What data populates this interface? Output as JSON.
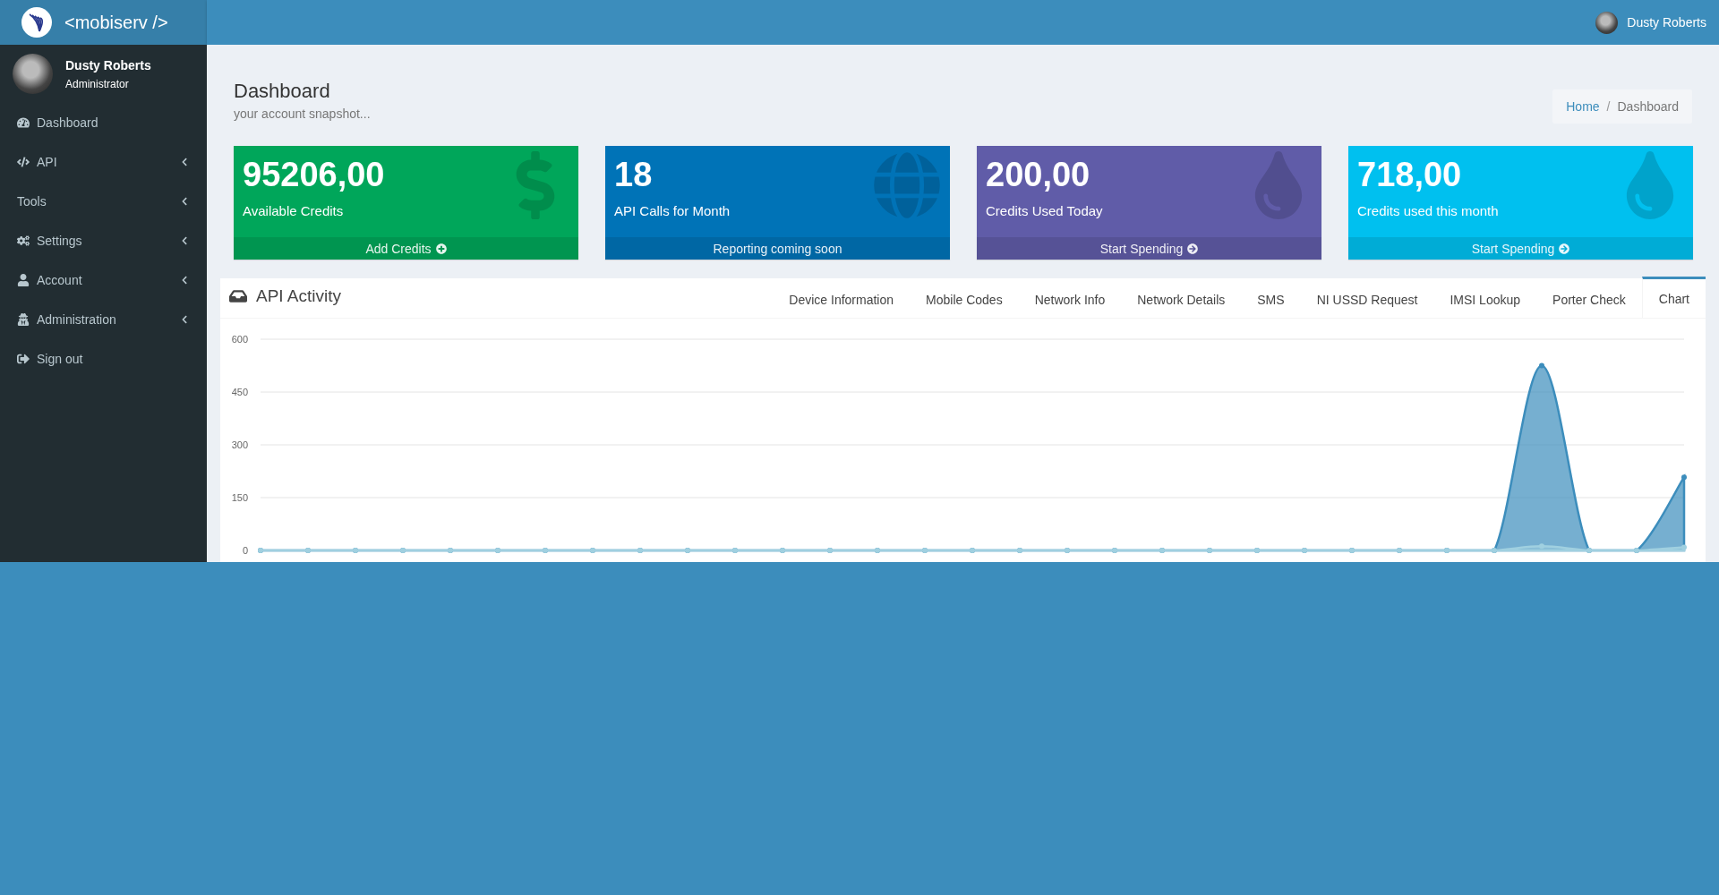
{
  "header": {
    "logo_text": "<mobiserv />",
    "user_name": "Dusty Roberts"
  },
  "sidebar": {
    "user": {
      "name": "Dusty Roberts",
      "role": "Administrator"
    },
    "items": [
      {
        "label": "Dashboard",
        "expandable": false
      },
      {
        "label": "API",
        "expandable": true
      },
      {
        "label": "Tools",
        "expandable": true
      },
      {
        "label": "Settings",
        "expandable": true
      },
      {
        "label": "Account",
        "expandable": true
      },
      {
        "label": "Administration",
        "expandable": true
      },
      {
        "label": "Sign out",
        "expandable": false
      }
    ]
  },
  "page": {
    "title": "Dashboard",
    "subtitle": "your account snapshot...",
    "breadcrumb": [
      "Home",
      "Dashboard"
    ],
    "breadcrumb_separator": "/"
  },
  "cards": [
    {
      "value": "95206,00",
      "label": "Available Credits",
      "footer": "Add Credits",
      "color": "#00a65a"
    },
    {
      "value": "18",
      "label": "API Calls for Month",
      "footer": "Reporting coming soon",
      "color": "#0073b7"
    },
    {
      "value": "200,00",
      "label": "Credits Used Today",
      "footer": "Start Spending",
      "color": "#605ca8"
    },
    {
      "value": "718,00",
      "label": "Credits used this month",
      "footer": "Start Spending",
      "color": "#00c0ef"
    }
  ],
  "activity": {
    "title": "API Activity",
    "tabs": [
      {
        "label": "Device Information",
        "selected": false
      },
      {
        "label": "Mobile Codes",
        "selected": false
      },
      {
        "label": "Network Info",
        "selected": false
      },
      {
        "label": "Network Details",
        "selected": false
      },
      {
        "label": "SMS",
        "selected": false
      },
      {
        "label": "NI USSD Request",
        "selected": false
      },
      {
        "label": "IMSI Lookup",
        "selected": false
      },
      {
        "label": "Porter Check",
        "selected": false
      },
      {
        "label": "Chart",
        "selected": true
      }
    ],
    "chart_data": {
      "type": "area",
      "grid": true,
      "ylim": [
        0,
        600
      ],
      "yticks": [
        0,
        150,
        300,
        450,
        600
      ],
      "series": [
        {
          "color": "#3c8dbc",
          "values": [
            0,
            0,
            0,
            0,
            0,
            0,
            0,
            0,
            0,
            0,
            0,
            0,
            0,
            0,
            0,
            0,
            0,
            0,
            0,
            0,
            0,
            0,
            0,
            0,
            0,
            0,
            0,
            525,
            0,
            0,
            208
          ]
        },
        {
          "color": "#a0d0e0",
          "values": [
            0,
            0,
            0,
            0,
            0,
            0,
            0,
            0,
            0,
            0,
            0,
            0,
            0,
            0,
            0,
            0,
            0,
            0,
            0,
            0,
            0,
            0,
            0,
            0,
            0,
            0,
            0,
            12,
            0,
            0,
            9
          ]
        }
      ]
    }
  }
}
